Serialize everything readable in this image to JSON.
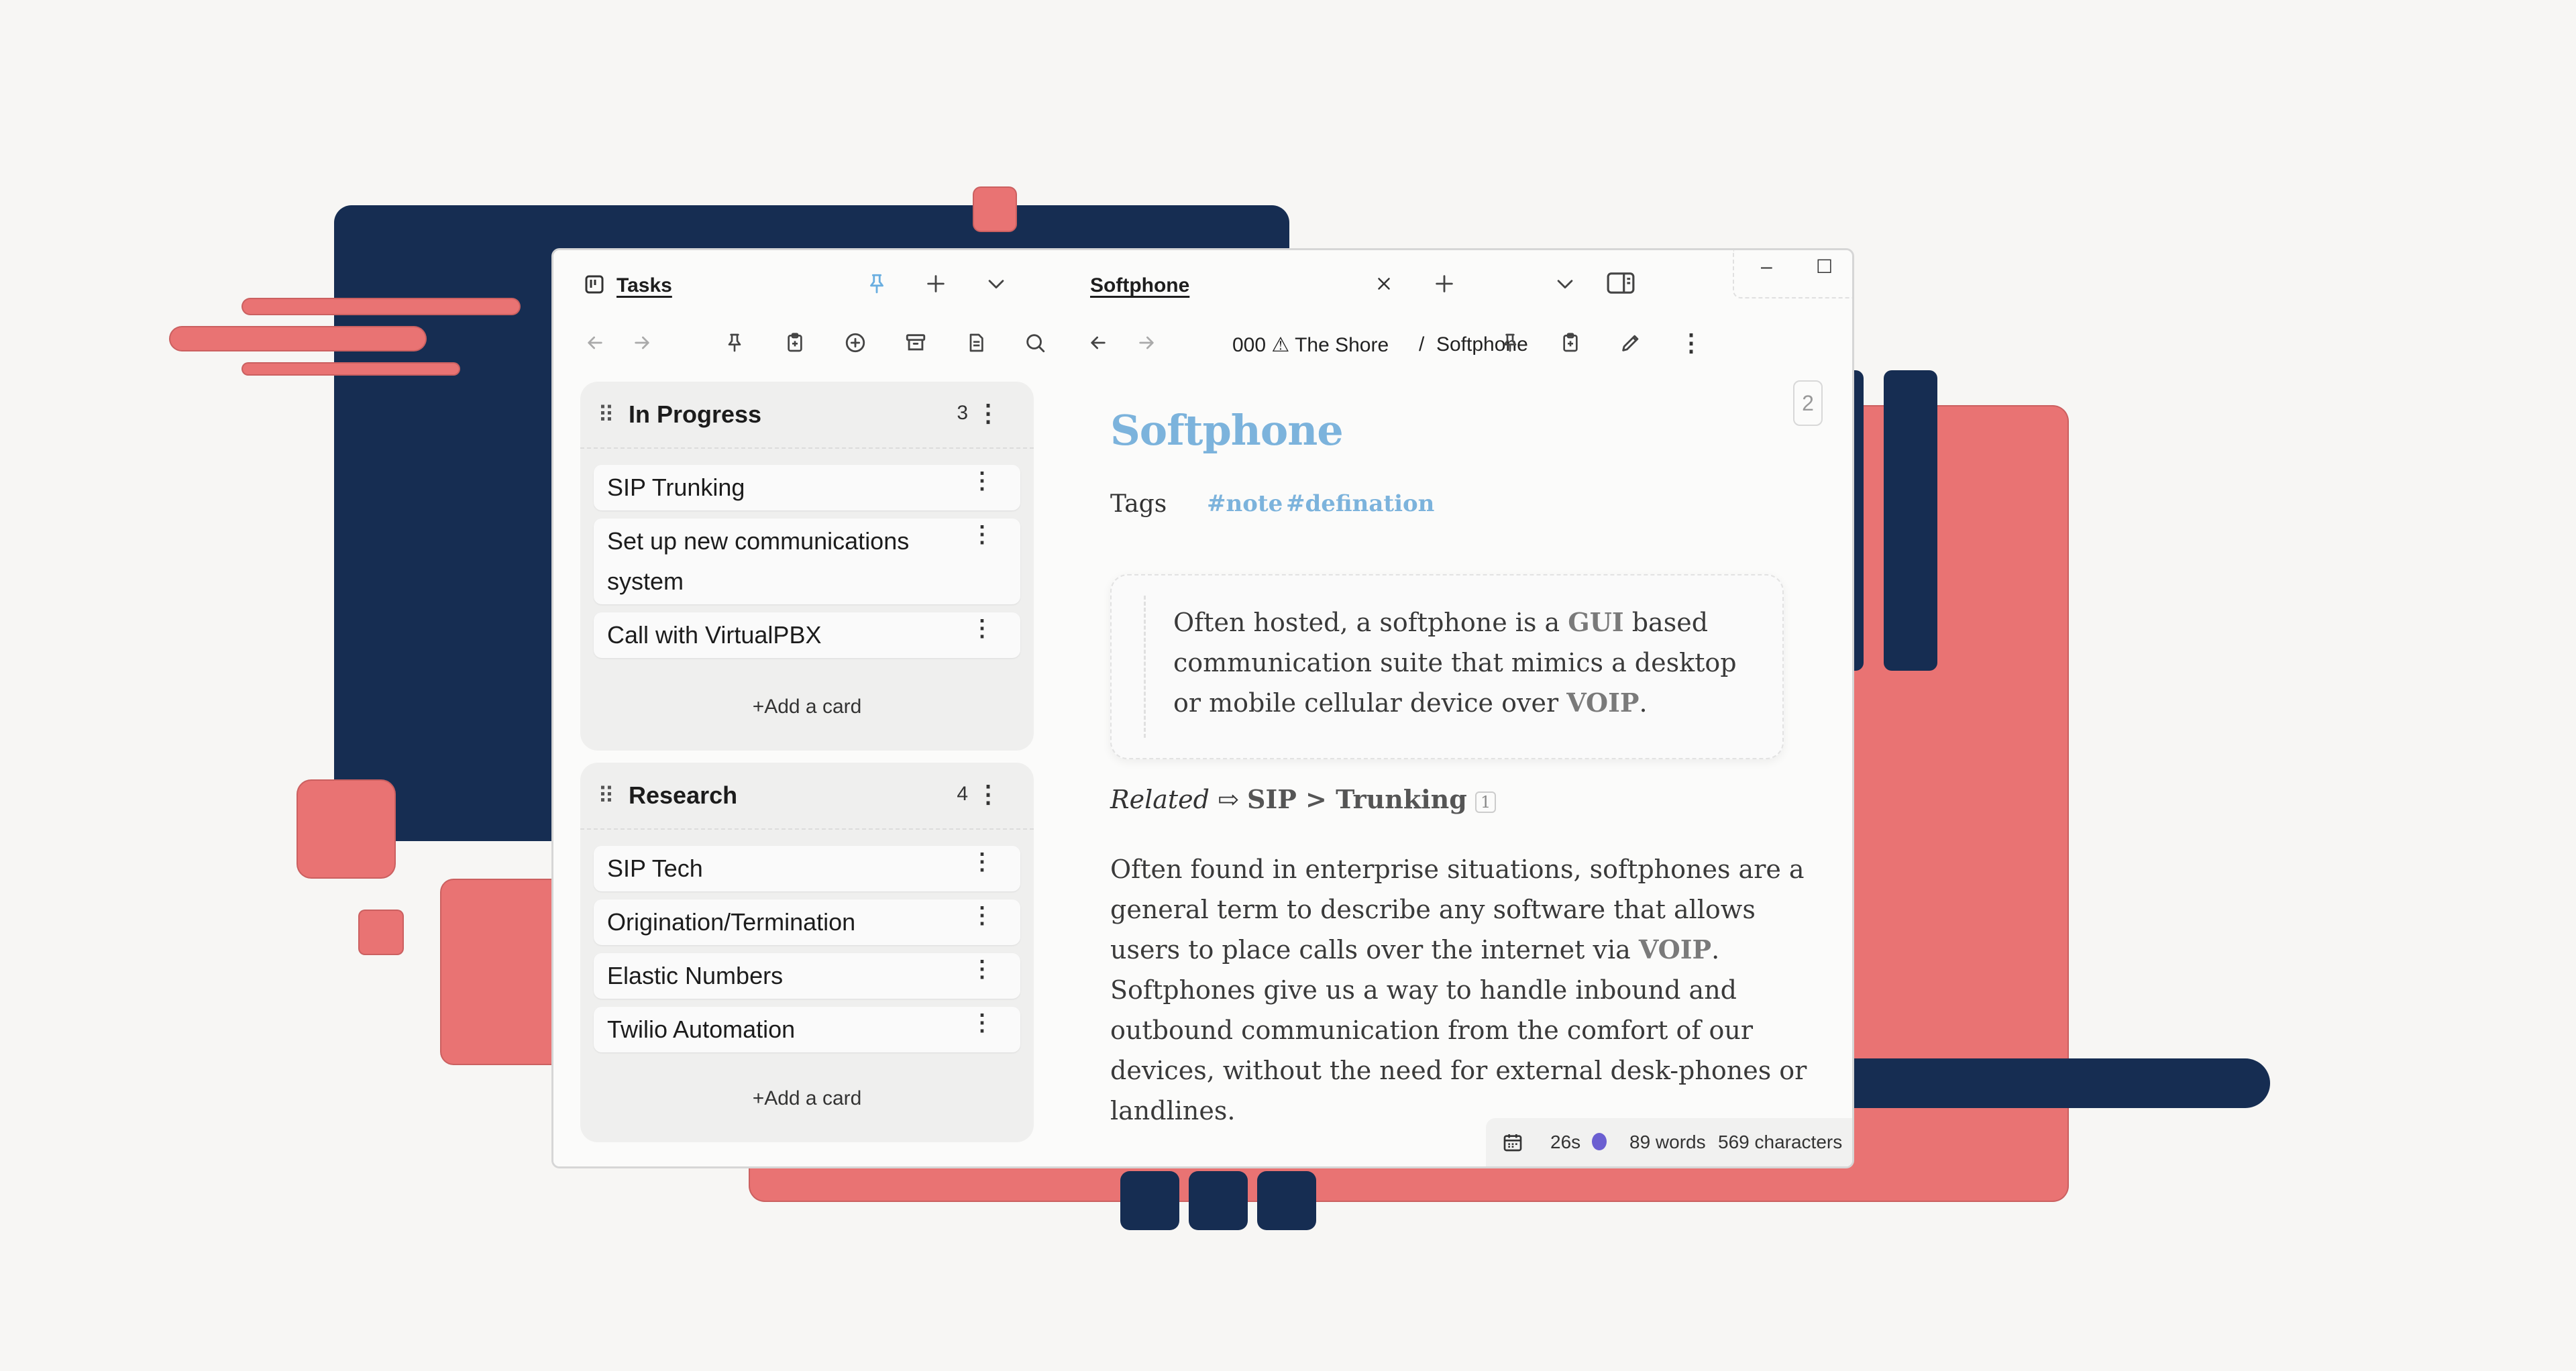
{
  "colors": {
    "navy": "#162d52",
    "coral": "#e97373",
    "accent_blue": "#7cb3dc",
    "background": "#f7f6f4"
  },
  "left_pane": {
    "tab": {
      "icon": "kanban-icon",
      "title": "Tasks"
    },
    "toolbar_icons": [
      "arrow-left-icon",
      "arrow-right-icon",
      "pin-icon",
      "clipboard-icon",
      "plus-circle-icon",
      "archive-icon",
      "document-icon",
      "search-icon"
    ],
    "lanes": [
      {
        "title": "In Progress",
        "count": "3",
        "cards": [
          "SIP Trunking",
          "Set up new communications system",
          "Call with VirtualPBX"
        ],
        "add_label": "+Add a card"
      },
      {
        "title": "Research",
        "count": "4",
        "cards": [
          "SIP Tech",
          "Origination/Termination",
          "Elastic Numbers",
          "Twilio Automation"
        ],
        "add_label": "+Add a card"
      }
    ]
  },
  "right_pane": {
    "tab": {
      "title": "Softphone"
    },
    "breadcrumb": {
      "folder": "000 ⚠ The Shore",
      "separator": "/",
      "current": "Softphone"
    },
    "note": {
      "title": "Softphone",
      "line_indicator": "2",
      "tags_label": "Tags",
      "tags": [
        "#note",
        "#defination"
      ],
      "callout": {
        "t1": "Often hosted, a softphone is a ",
        "b1": "GUI",
        "t2": " based communication suite that mimics a desktop or mobile cellular device over ",
        "b2": "VOIP",
        "t3": "."
      },
      "related": {
        "label": "Related",
        "arrow": "⇨",
        "link": "SIP > Trunking",
        "count": "1"
      },
      "body": {
        "t1": "Often found in enterprise situations, softphones are a general term to describe any software that allows users to place calls over the internet via ",
        "b1": "VOIP",
        "t2": ". Softphones give us a way to handle inbound and outbound communication from the comfort of our devices, without the need for external desk-phones or landlines."
      }
    },
    "status": {
      "time": "26s",
      "words": "89 words",
      "characters": "569 characters"
    }
  },
  "window_controls": {
    "minimize": "–",
    "maximize": "☐"
  }
}
